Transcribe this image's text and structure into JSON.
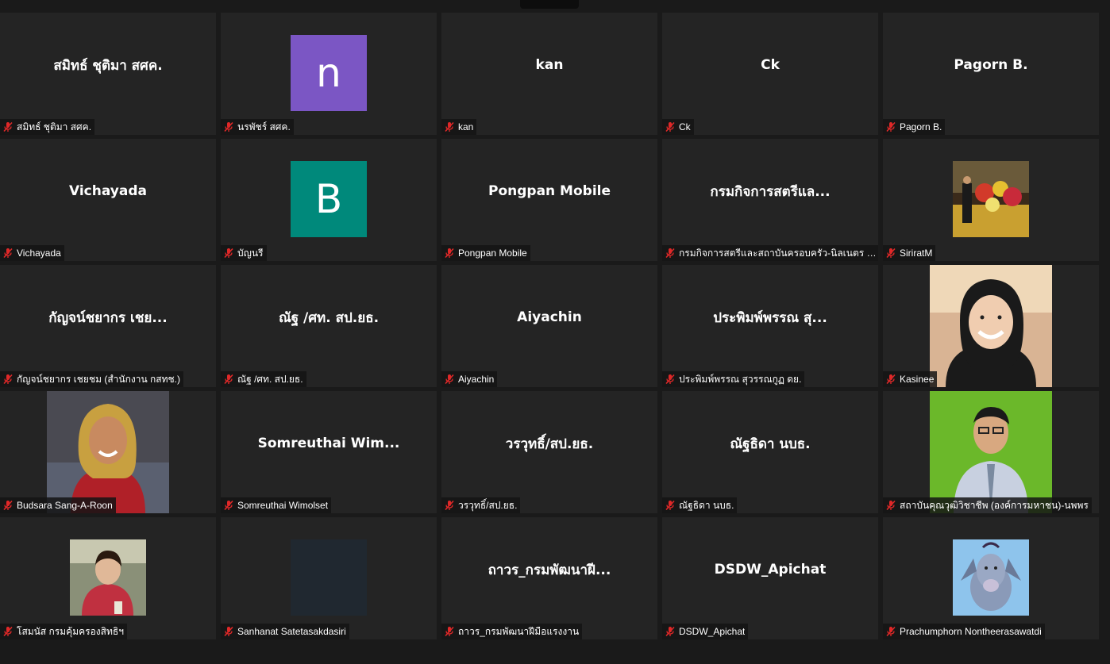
{
  "tiles": [
    {
      "name": "สมิทธ์ ชุติมา สศค.",
      "center": "สมิทธ์ ชุติมา สศค."
    },
    {
      "name": "นรพัชร์ สศค.",
      "avatar_letter": "n",
      "avatar_color": "#7b56c4"
    },
    {
      "name": "kan",
      "center": "kan"
    },
    {
      "name": "Ck",
      "center": "Ck"
    },
    {
      "name": "Pagorn B.",
      "center": "Pagorn B."
    },
    {
      "name": "Vichayada",
      "center": "Vichayada"
    },
    {
      "name": "บัญนรี",
      "avatar_letter": "B",
      "avatar_color": "#00897b"
    },
    {
      "name": "Pongpan Mobile",
      "center": "Pongpan Mobile"
    },
    {
      "name": "กรมกิจการสตรีและสถาบันครอบครัว-นิลเนตร บุบ...",
      "center": "กรมกิจการสตรีแล..."
    },
    {
      "name": "SiriratM",
      "photo": "event"
    },
    {
      "name": "กัญจน์ชยากร เชยชม (สำนักงาน กสทช.)",
      "center": "กัญจน์ชยากร เชย..."
    },
    {
      "name": "ณัฐ /ศท. สป.ยธ.",
      "center": "ณัฐ /ศท. สป.ยธ."
    },
    {
      "name": "Aiyachin",
      "center": "Aiyachin"
    },
    {
      "name": "ประพิมพ์พรรณ สุวรรณกูฏ ดย.",
      "center": "ประพิมพ์พรรณ สุ..."
    },
    {
      "name": "Kasinee",
      "photo": "woman-smile"
    },
    {
      "name": "Budsara Sang-A-Roon",
      "photo": "woman-red"
    },
    {
      "name": "Somreuthai Wimolset",
      "center": "Somreuthai  Wim..."
    },
    {
      "name": "วรวุทธิ์/สป.ยธ.",
      "center": "วรวุทธิ์/สป.ยธ."
    },
    {
      "name": "ณัฐธิดา นบธ.",
      "center": "ณัฐธิดา นบธ."
    },
    {
      "name": "สถาบันคุณวุฒิวิชาชีพ (องค์การมหาชน)-นพพร",
      "photo": "man-green"
    },
    {
      "name": "โสมนัส กรมคุ้มครองสิทธิฯ",
      "photo": "woman-cafe"
    },
    {
      "name": "Sanhanat Satetasakdasiri",
      "photo": "dark"
    },
    {
      "name": "ถาวร_กรมพัฒนาฝีมือแรงงาน",
      "center": "ถาวร_กรมพัฒนาฝี..."
    },
    {
      "name": "DSDW_Apichat",
      "center": "DSDW_Apichat"
    },
    {
      "name": "Prachumphorn Nontheerasawatdi",
      "photo": "cartoon"
    }
  ]
}
